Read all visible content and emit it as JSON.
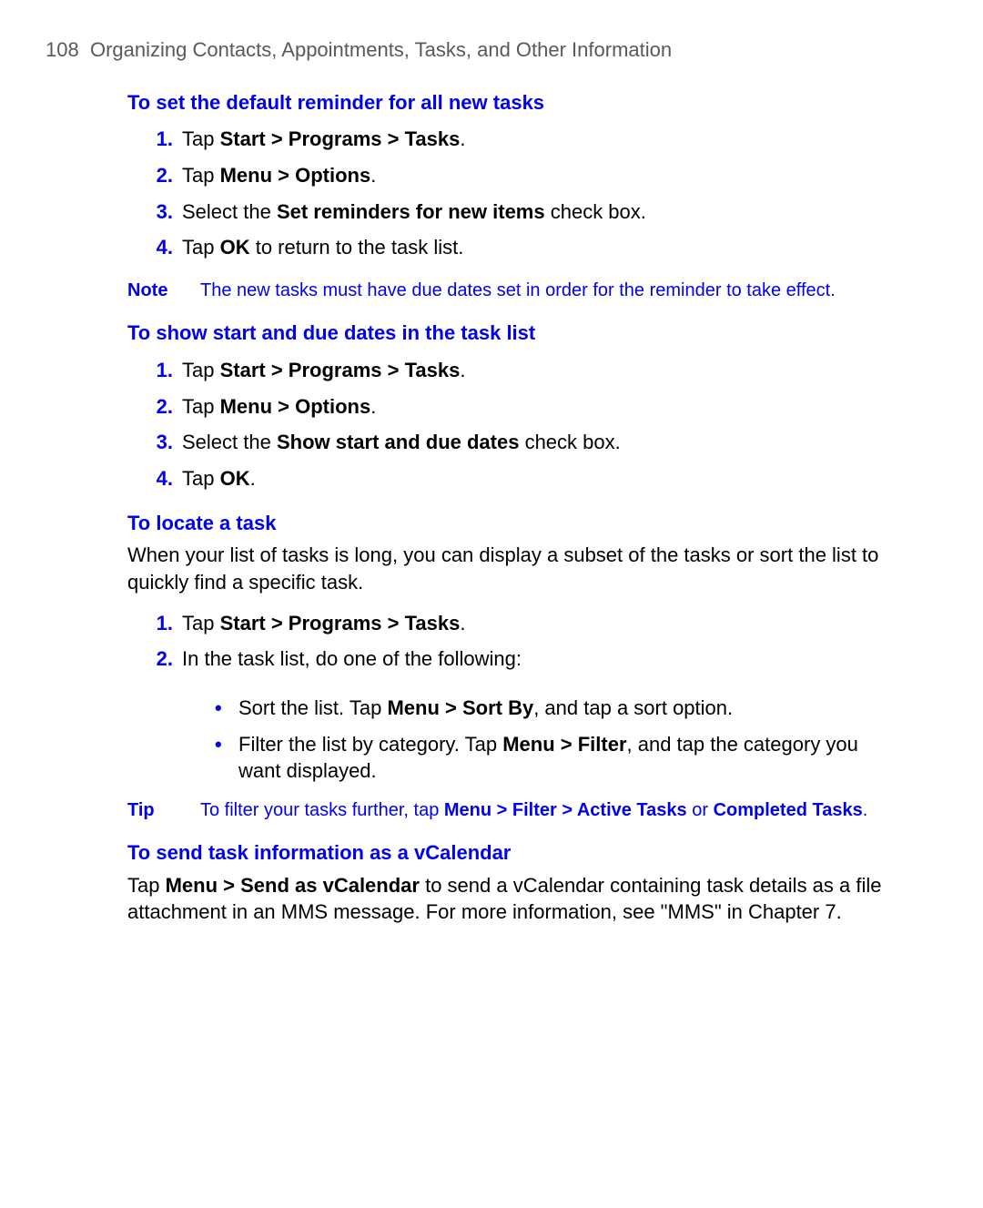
{
  "header": {
    "page_number": "108",
    "title": "Organizing Contacts, Appointments, Tasks, and Other Information"
  },
  "section1": {
    "heading": "To set the default reminder for all new tasks",
    "steps": {
      "s1": {
        "num": "1.",
        "pre": "Tap ",
        "bold": "Start > Programs > Tasks",
        "post": "."
      },
      "s2": {
        "num": "2.",
        "pre": "Tap ",
        "bold": "Menu > Options",
        "post": "."
      },
      "s3": {
        "num": "3.",
        "pre": "Select the ",
        "bold": "Set reminders for new items",
        "post": " check box."
      },
      "s4": {
        "num": "4.",
        "pre": "Tap ",
        "bold": "OK",
        "post": " to return to the task list."
      }
    },
    "note_label": "Note",
    "note_text": "The new tasks must have due dates set in order for the reminder to take effect."
  },
  "section2": {
    "heading": "To show start and due dates in the task list",
    "steps": {
      "s1": {
        "num": "1.",
        "pre": "Tap ",
        "bold": "Start > Programs > Tasks",
        "post": "."
      },
      "s2": {
        "num": "2.",
        "pre": "Tap ",
        "bold": "Menu > Options",
        "post": "."
      },
      "s3": {
        "num": "3.",
        "pre": "Select the ",
        "bold": "Show start and due dates",
        "post": " check box."
      },
      "s4": {
        "num": "4.",
        "pre": "Tap ",
        "bold": "OK",
        "post": "."
      }
    }
  },
  "section3": {
    "heading": "To locate a task",
    "intro": "When your list of tasks is long, you can display a subset of the tasks or sort the list to quickly find a specific task.",
    "steps": {
      "s1": {
        "num": "1.",
        "pre": "Tap ",
        "bold": "Start > Programs > Tasks",
        "post": "."
      },
      "s2": {
        "num": "2.",
        "text": "In the task list, do one of the following:"
      }
    },
    "bullets": {
      "b1": {
        "pre": "Sort the list. Tap ",
        "bold": "Menu > Sort By",
        "post": ", and tap a sort option."
      },
      "b2": {
        "pre": "Filter the list by category. Tap ",
        "bold": "Menu > Filter",
        "post": ", and tap the category you want displayed."
      }
    },
    "tip_label": "Tip",
    "tip": {
      "pre": "To filter your tasks further, tap ",
      "bold1": "Menu > Filter > Active Tasks",
      "mid": " or ",
      "bold2": "Completed Tasks",
      "post": "."
    }
  },
  "section4": {
    "heading": "To send task information as a vCalendar",
    "para": {
      "pre": "Tap ",
      "bold": "Menu > Send as vCalendar",
      "post": " to send a vCalendar containing task details as a file attachment in an MMS message. For more information, see \"MMS\" in Chapter 7."
    }
  }
}
